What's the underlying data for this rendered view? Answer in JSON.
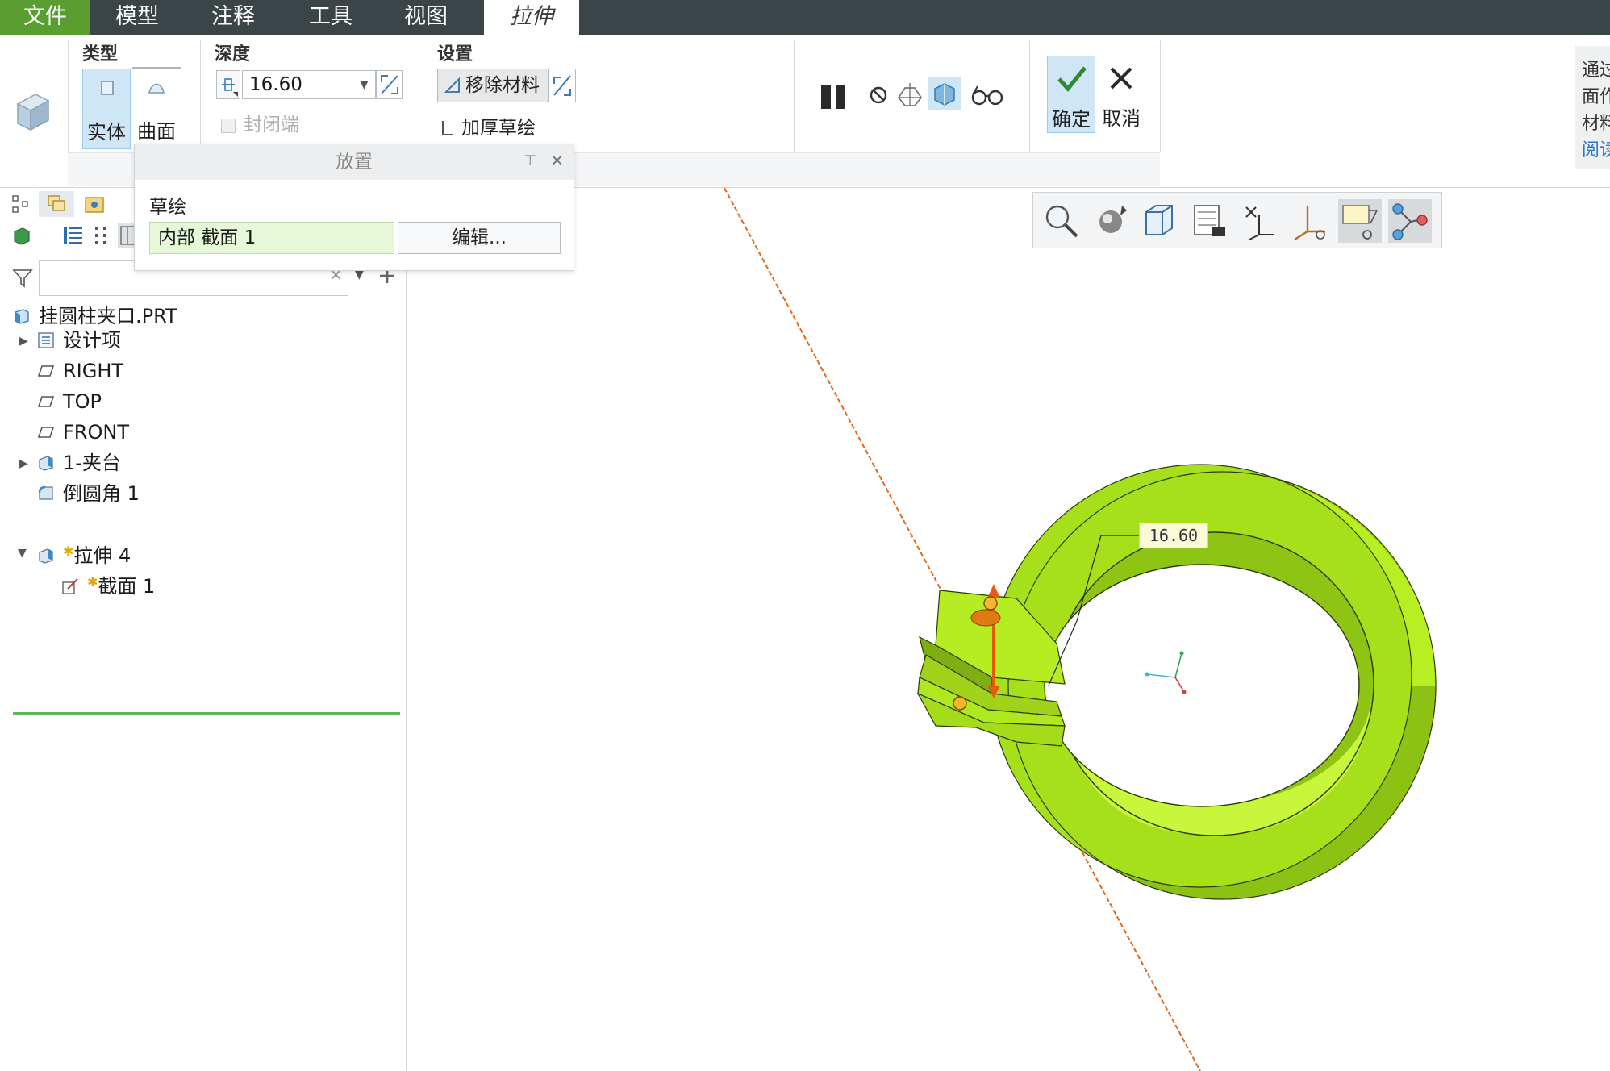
{
  "menu": {
    "file": "文件",
    "model": "模型",
    "annotate": "注释",
    "tools": "工具",
    "view": "视图",
    "active_tab": "拉伸"
  },
  "ribbon": {
    "type_group": {
      "title": "类型",
      "solid": "实体",
      "surface": "曲面"
    },
    "depth_group": {
      "title": "深度",
      "value": "16.60",
      "capped_ends": "封闭端"
    },
    "settings_group": {
      "title": "设置",
      "remove_material": "移除材料",
      "thicken_sketch": "加厚草绘"
    },
    "ok": "确定",
    "cancel": "取消",
    "help_lines": [
      "通过",
      "面作",
      "材料"
    ],
    "help_link": "阅读"
  },
  "placement": {
    "title": "放置",
    "sketch_label": "草绘",
    "sketch_value": "内部 截面 1",
    "edit_button": "编辑..."
  },
  "model_tree": {
    "root": "挂圆柱夹口.PRT",
    "items": [
      "设计项",
      "RIGHT",
      "TOP",
      "FRONT",
      "1-夹台",
      "倒圆角 1"
    ],
    "active_feature": "拉伸 4",
    "active_child": "截面 1"
  },
  "graphics": {
    "dimension": "16.60",
    "model_color": "#a8e31c"
  },
  "colors": {
    "menu_bg": "#3b4446",
    "file_tab": "#5a9e32",
    "selected_button": "#cfe6f7",
    "sketch_field": "#e6f8d8"
  }
}
